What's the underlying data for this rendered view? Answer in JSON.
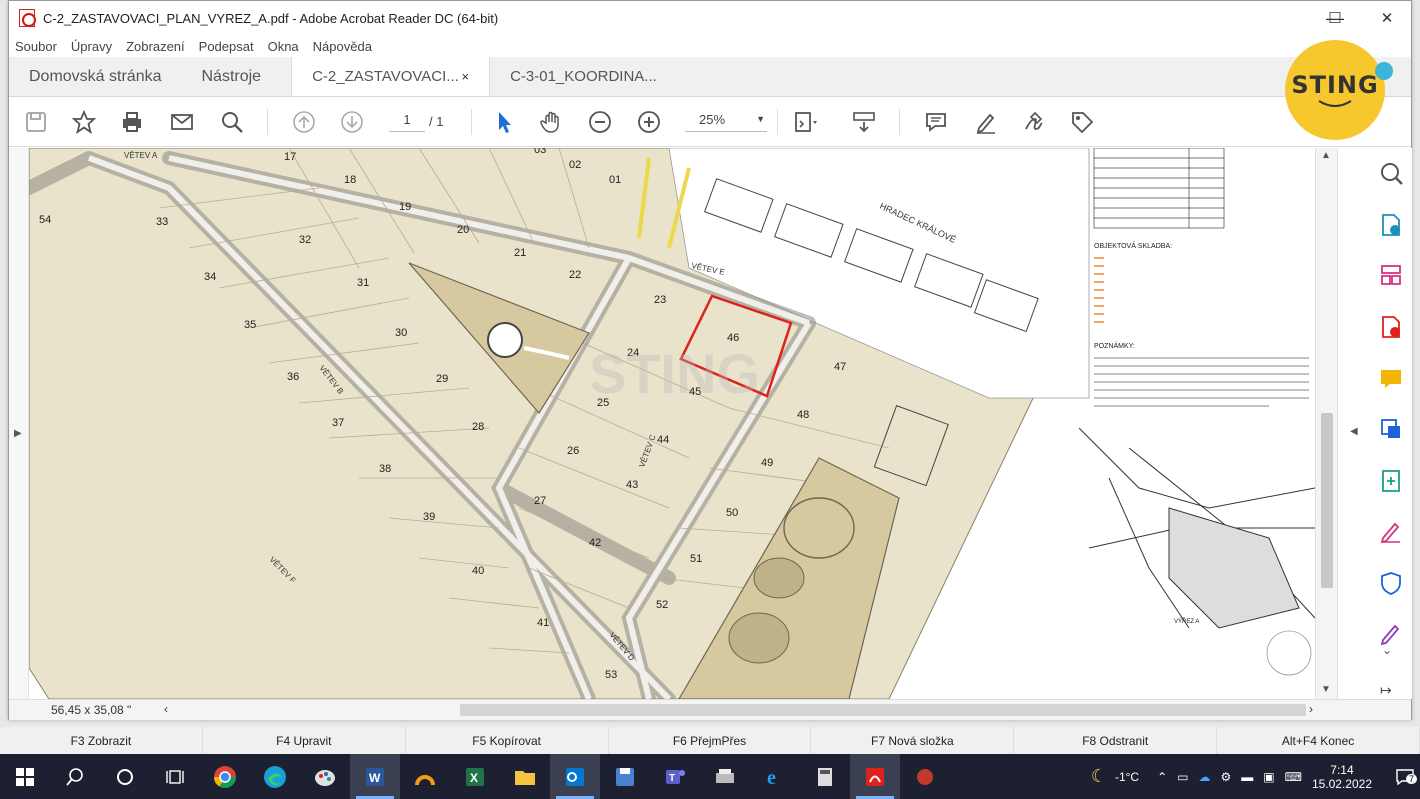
{
  "window": {
    "title": "C-2_ZASTAVOVACI_PLAN_VYREZ_A.pdf - Adobe Acrobat Reader DC (64-bit)",
    "controls": {
      "minimize": "—",
      "maximize": "☐",
      "close": "✕"
    }
  },
  "menu": [
    "Soubor",
    "Úpravy",
    "Zobrazení",
    "Podepsat",
    "Okna",
    "Nápověda"
  ],
  "tabs": {
    "home": "Domovská stránka",
    "tools": "Nástroje",
    "docs": [
      {
        "label": "C-2_ZASTAVOVACI...",
        "close": "×",
        "active": true
      },
      {
        "label": "C-3-01_KOORDINA...",
        "active": false
      }
    ]
  },
  "toolbar": {
    "page_current": "1",
    "page_total": "/ 1",
    "zoom": "25%"
  },
  "plan": {
    "lots": [
      "01",
      "02",
      "03",
      "17",
      "18",
      "19",
      "20",
      "21",
      "22",
      "23",
      "24",
      "25",
      "26",
      "27",
      "28",
      "29",
      "30",
      "31",
      "32",
      "33",
      "34",
      "35",
      "36",
      "37",
      "38",
      "39",
      "40",
      "41",
      "42",
      "43",
      "44",
      "45",
      "46",
      "47",
      "48",
      "49",
      "50",
      "51",
      "52",
      "53",
      "54"
    ],
    "roads": [
      "VĚTEV B",
      "VĚTEV C",
      "VĚTEV D",
      "VĚTEV E",
      "VĚTEV A",
      "VĚTEV F"
    ],
    "road_label": "HRADEC KRÁLOVÉ",
    "legend_title": "OBJEKTOVÁ SKLADBA:",
    "notes_title": "POZNÁMKY:",
    "inset_label": "VÝŘEZ A",
    "highlight_lot": "46"
  },
  "status": {
    "page_size": "56,45 x 35,08 \""
  },
  "fnbar": [
    "F3 Zobrazit",
    "F4 Upravit",
    "F5 Kopírovat",
    "F6 PřejmPřes",
    "F7 Nová složka",
    "F8 Odstranit",
    "Alt+F4 Konec"
  ],
  "taskbar": {
    "weather": "-1°C",
    "time": "7:14",
    "date": "15.02.2022",
    "notifications": "7"
  },
  "logo": {
    "text": "STING"
  },
  "colors": {
    "plan_fill": "#e9e3cb",
    "park_fill": "#d6c9a0",
    "highlight": "#e0201c",
    "logo": "#f6c82e",
    "taskbar": "#1c2030"
  }
}
